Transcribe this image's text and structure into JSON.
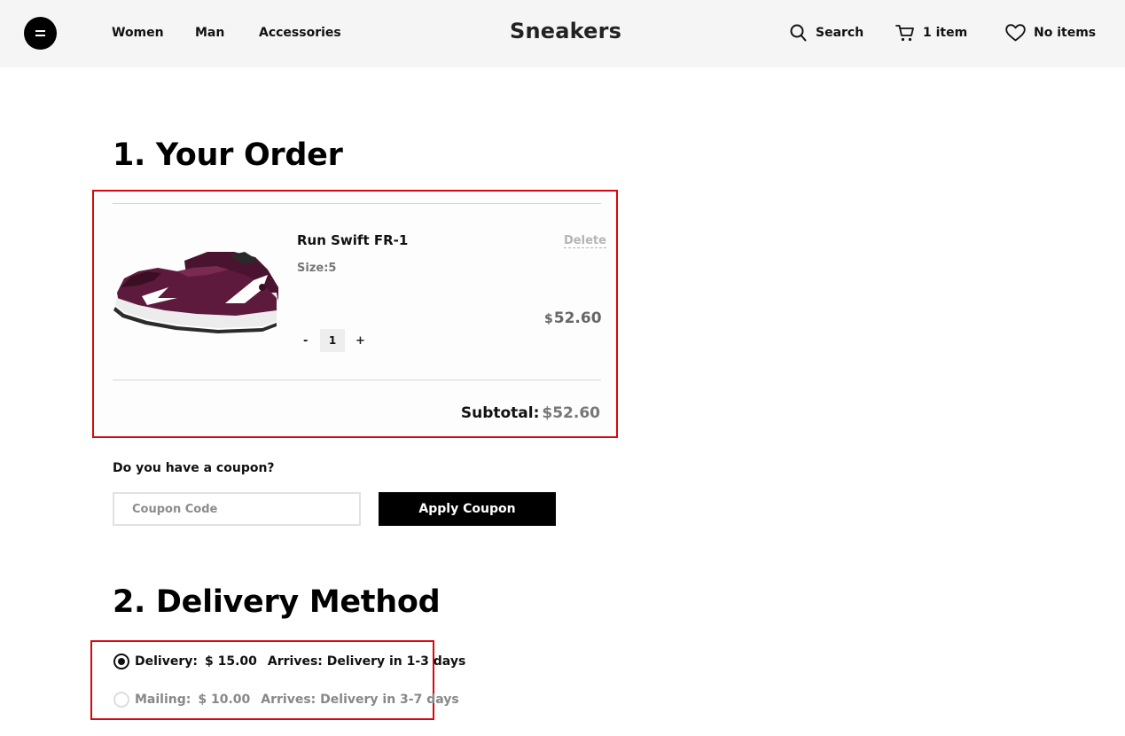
{
  "header": {
    "nav": [
      "Women",
      "Man",
      "Accessories"
    ],
    "brand": "Sneakers",
    "search_label": "Search",
    "cart_label": "1 item",
    "wishlist_label": "No items"
  },
  "order": {
    "title": "1. Your Order",
    "item": {
      "name": "Run Swift FR-1",
      "size": "Size:5",
      "delete_label": "Delete",
      "price_symbol": "$",
      "price": "52.60",
      "quantity": "1",
      "qty_minus": "-",
      "qty_plus": "+"
    },
    "subtotal_label": "Subtotal:",
    "subtotal_value": "$52.60"
  },
  "coupon": {
    "question": "Do you have a coupon?",
    "placeholder": "Coupon Code",
    "button_label": "Apply Coupon"
  },
  "delivery": {
    "title": "2. Delivery Method",
    "options": [
      {
        "label": "Delivery:",
        "price": "$ 15.00",
        "arrives": "Arrives: Delivery in 1-3 days",
        "selected": true
      },
      {
        "label": "Mailing:",
        "price": "$ 10.00",
        "arrives": "Arrives: Delivery in 3-7 days",
        "selected": false
      }
    ]
  },
  "colors": {
    "highlight_border": "#d8070e",
    "header_bg": "#f5f5f5",
    "shoe_primary": "#5e1a3c",
    "button_bg": "#000000"
  },
  "icons": {
    "menu": "menu-icon",
    "search": "search-icon",
    "cart": "cart-icon",
    "wishlist": "heart-icon"
  }
}
